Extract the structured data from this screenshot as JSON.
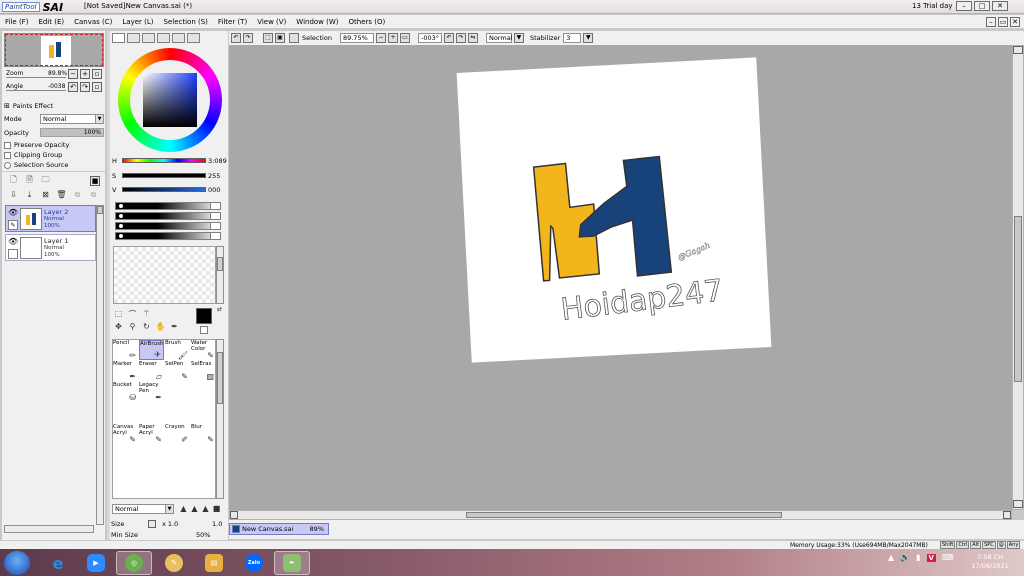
{
  "titlebar": {
    "brand_small": "PaintTool",
    "brand_big": "SAI",
    "window_title": "[Not Saved]New Canvas.sai (*)",
    "trial": "13 Trial day"
  },
  "menu": [
    "File (F)",
    "Edit (E)",
    "Canvas (C)",
    "Layer (L)",
    "Selection (S)",
    "Filter (T)",
    "View (V)",
    "Window (W)",
    "Others (O)"
  ],
  "navigator": {
    "zoom_label": "Zoom",
    "zoom_value": "89.8%",
    "angle_label": "Angle",
    "angle_value": "-0038"
  },
  "properties": {
    "paints_effect": "Paints Effect",
    "mode_label": "Mode",
    "mode_value": "Normal",
    "opacity_label": "Opacity",
    "opacity_value": "100%",
    "preserve_opacity": "Preserve Opacity",
    "clipping_group": "Clipping Group",
    "selection_source": "Selection Source"
  },
  "layers": [
    {
      "name": "Layer 2",
      "mode": "Normal",
      "opacity": "100%",
      "selected": true
    },
    {
      "name": "Layer 1",
      "mode": "Normal",
      "opacity": "100%",
      "selected": false
    }
  ],
  "hsv": {
    "h_label": "H",
    "h_value": "3:089",
    "s_label": "S",
    "s_value": "255",
    "v_label": "V",
    "v_value": "000"
  },
  "tools": [
    {
      "name": "Pencil",
      "icon": "pencil-icon"
    },
    {
      "name": "AirBrush",
      "icon": "airbrush-icon",
      "selected": true
    },
    {
      "name": "Brush",
      "icon": "brush-icon"
    },
    {
      "name": "Water Color",
      "icon": "watercolor-icon"
    },
    {
      "name": "Marker",
      "icon": "marker-icon"
    },
    {
      "name": "Eraser",
      "icon": "eraser-icon"
    },
    {
      "name": "SelPen",
      "icon": "selpen-icon"
    },
    {
      "name": "SelEras",
      "icon": "selerase-icon"
    },
    {
      "name": "Bucket",
      "icon": "bucket-icon"
    },
    {
      "name": "Legacy Pen",
      "icon": "legacy-pen-icon"
    },
    {
      "name": "Canvas Acryl",
      "icon": "canvas-acryl-icon"
    },
    {
      "name": "Paper Acryl",
      "icon": "paper-acryl-icon"
    },
    {
      "name": "Crayon",
      "icon": "crayon-icon"
    },
    {
      "name": "Blur",
      "icon": "blur-icon"
    }
  ],
  "brush": {
    "mode_value": "Normal",
    "size_label": "Size",
    "size_mult": "x 1.0",
    "size_value": "1.0",
    "minsize_label": "Min Size",
    "minsize_value": "50%"
  },
  "canvas_toolbar": {
    "selection_label": "Selection",
    "zoom_value": "89.75%",
    "angle_value": "-003°",
    "blend_value": "Normal",
    "stabilizer_label": "Stabilizer",
    "stabilizer_value": "3"
  },
  "artwork": {
    "text": "Hoidap247",
    "signature": "@Gagah",
    "yellow": "#F2B51C",
    "blue": "#18437A"
  },
  "doctab": {
    "name": "New Canvas.sai",
    "zoom": "89%"
  },
  "status": {
    "memory": "Memory Usage:33% (Use694MB/Max2047MB)",
    "keys": [
      "Shift",
      "Ctrl",
      "Alt",
      "SPC",
      "@",
      "Any"
    ]
  },
  "clock": {
    "time": "7:58 CH",
    "date": "17/06/2021"
  },
  "taskbar_apps": [
    "start-icon",
    "ie-icon",
    "zoom-icon",
    "cococ-icon",
    "paint-icon",
    "explorer-icon",
    "zalo-icon",
    "sai-icon"
  ]
}
